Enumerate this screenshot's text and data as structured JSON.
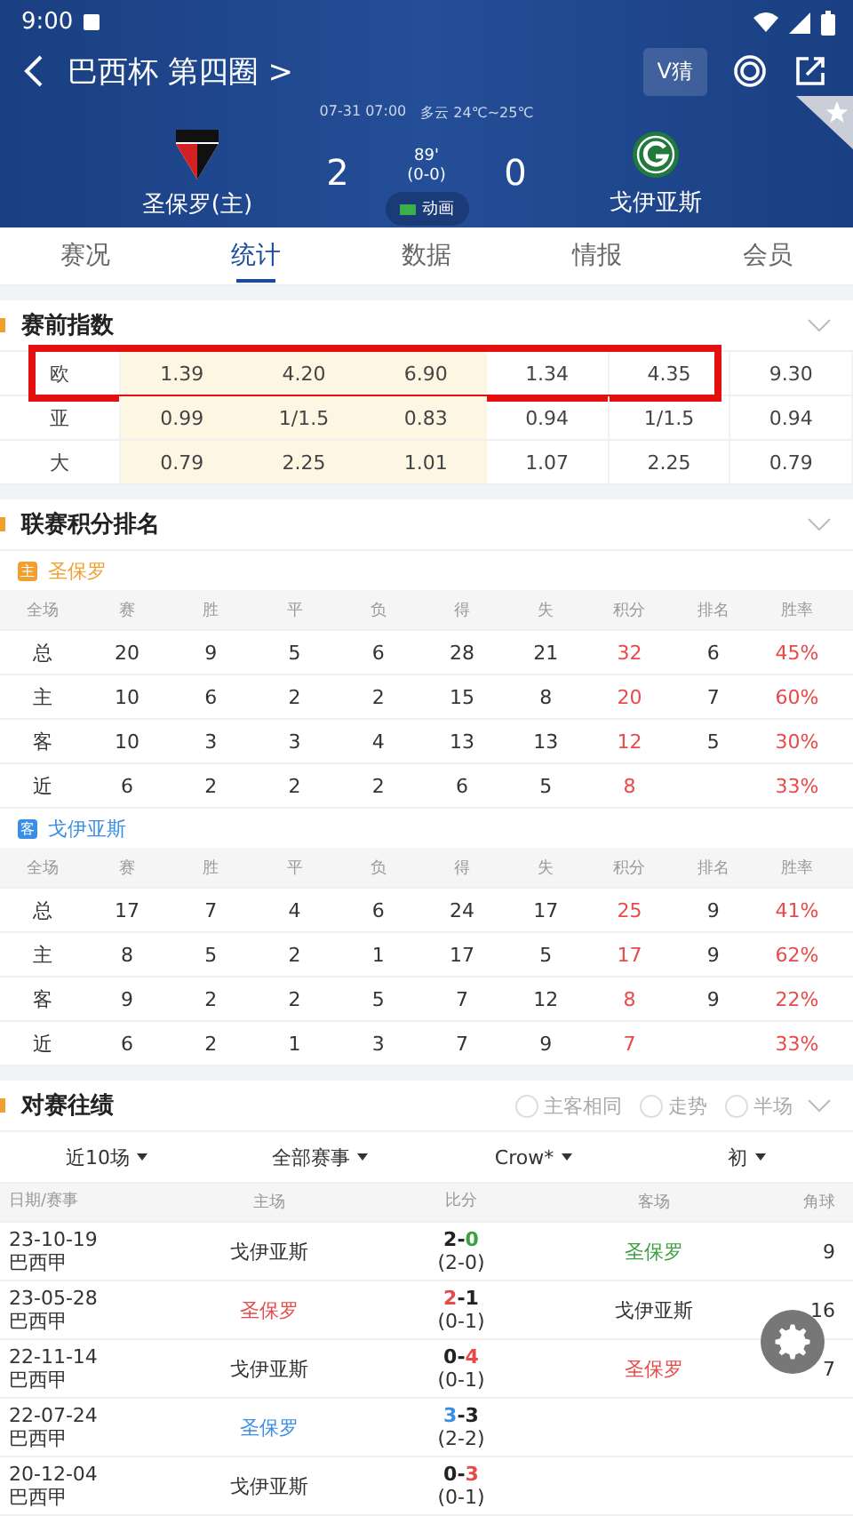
{
  "status_bar": {
    "time": "9:00"
  },
  "header": {
    "title": "巴西杯 第四圈 >",
    "guess_button": "V猜",
    "datetime": "07-31 07:00",
    "weather": "多云 24℃~25℃",
    "home": {
      "name": "圣保罗(主)",
      "score": "2"
    },
    "away": {
      "name": "戈伊亚斯",
      "score": "0"
    },
    "minute": "89'",
    "half_score": "(0-0)",
    "animation_button": "动画",
    "favorite": false
  },
  "tabs": [
    {
      "label": "赛况",
      "selected": false
    },
    {
      "label": "统计",
      "selected": true
    },
    {
      "label": "数据",
      "selected": false
    },
    {
      "label": "情报",
      "selected": false
    },
    {
      "label": "会员",
      "selected": false
    }
  ],
  "odds": {
    "title": "赛前指数",
    "rows": [
      {
        "label": "欧",
        "initial": [
          "1.39",
          "4.20",
          "6.90"
        ],
        "live": [
          "1.34",
          "4.35",
          "9.30"
        ],
        "highlighted": true
      },
      {
        "label": "亚",
        "initial": [
          "0.99",
          "1/1.5",
          "0.83"
        ],
        "live": [
          "0.94",
          "1/1.5",
          "0.94"
        ],
        "highlighted": false
      },
      {
        "label": "大",
        "initial": [
          "0.79",
          "2.25",
          "1.01"
        ],
        "live": [
          "1.07",
          "2.25",
          "0.79"
        ],
        "highlighted": false
      }
    ]
  },
  "standings": {
    "title": "联赛积分排名",
    "teams": [
      {
        "badge": "主",
        "name": "圣保罗",
        "color": "#f0a030",
        "columns": [
          "全场",
          "赛",
          "胜",
          "平",
          "负",
          "得",
          "失",
          "积分",
          "排名",
          "胜率"
        ],
        "rows": [
          [
            "总",
            "20",
            "9",
            "5",
            "6",
            "28",
            "21",
            {
              "text": "32",
              "color": "#e84a4a"
            },
            "6",
            {
              "text": "45%",
              "color": "#e84a4a"
            }
          ],
          [
            "主",
            "10",
            "6",
            "2",
            "2",
            "15",
            "8",
            {
              "text": "20",
              "color": "#e84a4a"
            },
            "7",
            {
              "text": "60%",
              "color": "#e84a4a"
            }
          ],
          [
            "客",
            "10",
            "3",
            "3",
            "4",
            "13",
            "13",
            {
              "text": "12",
              "color": "#e84a4a"
            },
            "5",
            {
              "text": "30%",
              "color": "#e84a4a"
            }
          ],
          [
            "近",
            "6",
            "2",
            "2",
            "2",
            "6",
            "5",
            {
              "text": "8",
              "color": "#e84a4a"
            },
            "",
            {
              "text": "33%",
              "color": "#e84a4a"
            }
          ]
        ]
      },
      {
        "badge": "客",
        "name": "戈伊亚斯",
        "color": "#3a8ee6",
        "columns": [
          "全场",
          "赛",
          "胜",
          "平",
          "负",
          "得",
          "失",
          "积分",
          "排名",
          "胜率"
        ],
        "rows": [
          [
            "总",
            "17",
            "7",
            "4",
            "6",
            "24",
            "17",
            {
              "text": "25",
              "color": "#e84a4a"
            },
            "9",
            {
              "text": "41%",
              "color": "#e84a4a"
            }
          ],
          [
            "主",
            "8",
            "5",
            "2",
            "1",
            "17",
            "5",
            {
              "text": "17",
              "color": "#e84a4a"
            },
            "9",
            {
              "text": "62%",
              "color": "#e84a4a"
            }
          ],
          [
            "客",
            "9",
            "2",
            "2",
            "5",
            "7",
            "12",
            {
              "text": "8",
              "color": "#e84a4a"
            },
            "9",
            {
              "text": "22%",
              "color": "#e84a4a"
            }
          ],
          [
            "近",
            "6",
            "2",
            "1",
            "3",
            "7",
            "9",
            {
              "text": "7",
              "color": "#e84a4a"
            },
            "",
            {
              "text": "33%",
              "color": "#e84a4a"
            }
          ]
        ]
      }
    ]
  },
  "h2h": {
    "title": "对赛往绩",
    "options": [
      {
        "label": "主客相同",
        "checked": false
      },
      {
        "label": "走势",
        "checked": false
      },
      {
        "label": "半场",
        "checked": false
      }
    ],
    "filters": [
      "近10场",
      "全部赛事",
      "Crow*",
      "初"
    ],
    "columns": [
      "日期/赛事",
      "主场",
      "比分",
      "客场",
      "角球"
    ],
    "matches": [
      {
        "date": "23-10-19",
        "league": "巴西甲",
        "home": {
          "name": "戈伊亚斯"
        },
        "away": {
          "name": "圣保罗",
          "color": "#3aa040"
        },
        "score": [
          {
            "text": "2"
          },
          {
            "text": "-"
          },
          {
            "text": "0",
            "color": "#3aa040"
          }
        ],
        "half": "(2-0)",
        "corners": "9"
      },
      {
        "date": "23-05-28",
        "league": "巴西甲",
        "home": {
          "name": "圣保罗",
          "color": "#e84a4a"
        },
        "away": {
          "name": "戈伊亚斯"
        },
        "score": [
          {
            "text": "2",
            "color": "#e84a4a"
          },
          {
            "text": "-"
          },
          {
            "text": "1"
          }
        ],
        "half": "(0-1)",
        "corners": "16"
      },
      {
        "date": "22-11-14",
        "league": "巴西甲",
        "home": {
          "name": "戈伊亚斯"
        },
        "away": {
          "name": "圣保罗",
          "color": "#e84a4a"
        },
        "score": [
          {
            "text": "0"
          },
          {
            "text": "-"
          },
          {
            "text": "4",
            "color": "#e84a4a"
          }
        ],
        "half": "(0-1)",
        "corners": "7"
      },
      {
        "date": "22-07-24",
        "league": "巴西甲",
        "home": {
          "name": "圣保罗",
          "color": "#3a8ee6"
        },
        "score": [
          {
            "text": "3",
            "color": "#3a8ee6"
          },
          {
            "text": "-"
          },
          {
            "text": "3"
          }
        ],
        "half": "(2-2)"
      },
      {
        "date": "20-12-04",
        "league": "巴西甲",
        "home": {
          "name": "戈伊亚斯"
        },
        "score": [
          {
            "text": "0"
          },
          {
            "text": "-"
          },
          {
            "text": "3",
            "color": "#e84a4a"
          }
        ],
        "half": "(0-1)"
      }
    ]
  }
}
